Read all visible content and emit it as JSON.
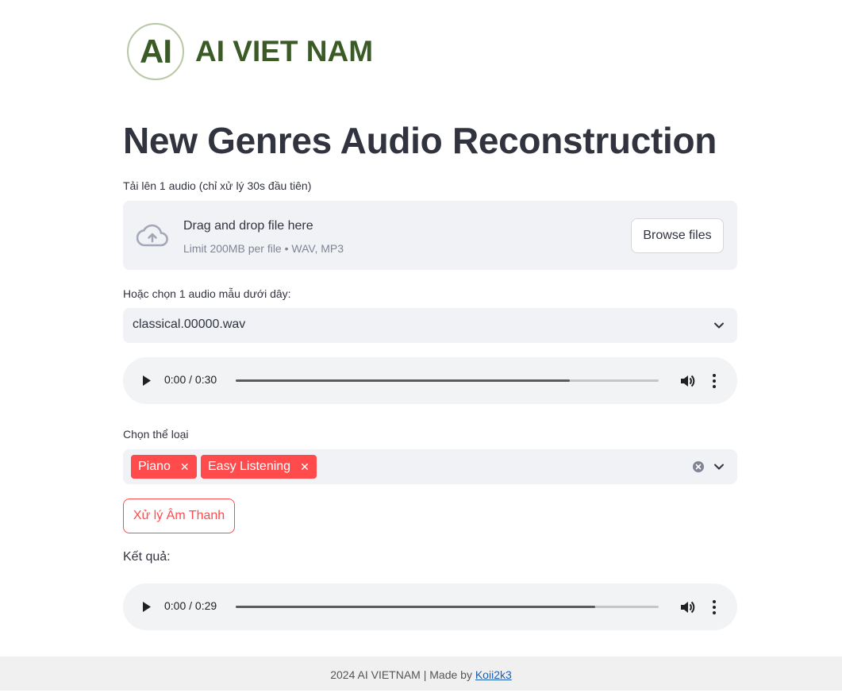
{
  "logo": {
    "mark": "AI",
    "text": "AI VIET NAM",
    "color": "#3a5a26"
  },
  "page_title": "New Genres Audio Reconstruction",
  "uploader": {
    "label": "Tải lên 1 audio (chỉ xử lý 30s đầu tiên)",
    "drag_text": "Drag and drop file here",
    "limit_text": "Limit 200MB per file • WAV, MP3",
    "browse_label": "Browse files",
    "icon": "cloud-upload-icon"
  },
  "sample_select": {
    "label": "Hoặc chọn 1 audio mẫu dưới dây:",
    "value": "classical.00000.wav"
  },
  "audio_input": {
    "time": "0:00 / 0:30",
    "progress_fraction": 0.79
  },
  "genre_select": {
    "label": "Chọn thể loại",
    "tags": [
      "Piano",
      "Easy Listening"
    ],
    "tag_color": "#ff4b4b"
  },
  "process_button": {
    "label": "Xử lý Âm Thanh",
    "color": "#ff4b4b"
  },
  "result": {
    "label": "Kết quả:",
    "time": "0:00 / 0:29",
    "progress_fraction": 0.85
  },
  "footer": {
    "text": "2024 AI VIETNAM | Made by ",
    "link_text": "Koii2k3"
  }
}
